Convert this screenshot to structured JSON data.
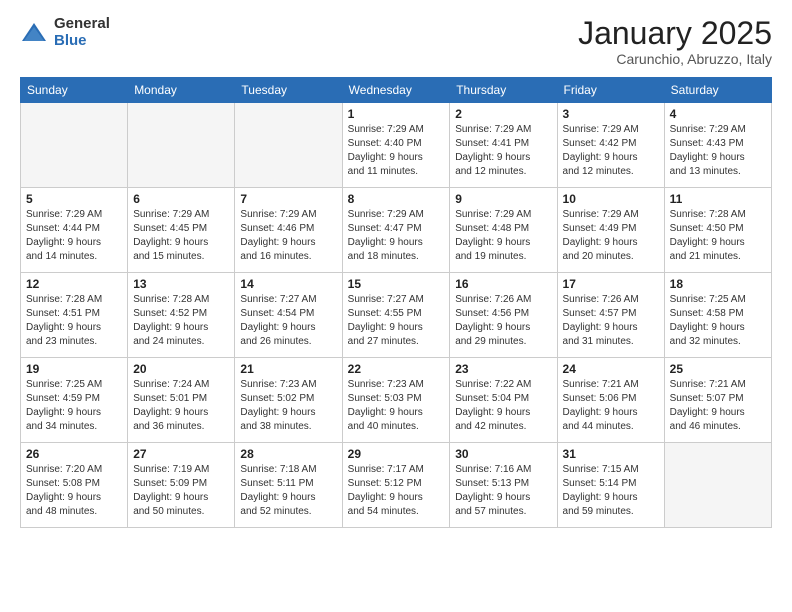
{
  "logo": {
    "general": "General",
    "blue": "Blue"
  },
  "title": "January 2025",
  "location": "Carunchio, Abruzzo, Italy",
  "days_header": [
    "Sunday",
    "Monday",
    "Tuesday",
    "Wednesday",
    "Thursday",
    "Friday",
    "Saturday"
  ],
  "weeks": [
    [
      {
        "num": "",
        "info": ""
      },
      {
        "num": "",
        "info": ""
      },
      {
        "num": "",
        "info": ""
      },
      {
        "num": "1",
        "info": "Sunrise: 7:29 AM\nSunset: 4:40 PM\nDaylight: 9 hours\nand 11 minutes."
      },
      {
        "num": "2",
        "info": "Sunrise: 7:29 AM\nSunset: 4:41 PM\nDaylight: 9 hours\nand 12 minutes."
      },
      {
        "num": "3",
        "info": "Sunrise: 7:29 AM\nSunset: 4:42 PM\nDaylight: 9 hours\nand 12 minutes."
      },
      {
        "num": "4",
        "info": "Sunrise: 7:29 AM\nSunset: 4:43 PM\nDaylight: 9 hours\nand 13 minutes."
      }
    ],
    [
      {
        "num": "5",
        "info": "Sunrise: 7:29 AM\nSunset: 4:44 PM\nDaylight: 9 hours\nand 14 minutes."
      },
      {
        "num": "6",
        "info": "Sunrise: 7:29 AM\nSunset: 4:45 PM\nDaylight: 9 hours\nand 15 minutes."
      },
      {
        "num": "7",
        "info": "Sunrise: 7:29 AM\nSunset: 4:46 PM\nDaylight: 9 hours\nand 16 minutes."
      },
      {
        "num": "8",
        "info": "Sunrise: 7:29 AM\nSunset: 4:47 PM\nDaylight: 9 hours\nand 18 minutes."
      },
      {
        "num": "9",
        "info": "Sunrise: 7:29 AM\nSunset: 4:48 PM\nDaylight: 9 hours\nand 19 minutes."
      },
      {
        "num": "10",
        "info": "Sunrise: 7:29 AM\nSunset: 4:49 PM\nDaylight: 9 hours\nand 20 minutes."
      },
      {
        "num": "11",
        "info": "Sunrise: 7:28 AM\nSunset: 4:50 PM\nDaylight: 9 hours\nand 21 minutes."
      }
    ],
    [
      {
        "num": "12",
        "info": "Sunrise: 7:28 AM\nSunset: 4:51 PM\nDaylight: 9 hours\nand 23 minutes."
      },
      {
        "num": "13",
        "info": "Sunrise: 7:28 AM\nSunset: 4:52 PM\nDaylight: 9 hours\nand 24 minutes."
      },
      {
        "num": "14",
        "info": "Sunrise: 7:27 AM\nSunset: 4:54 PM\nDaylight: 9 hours\nand 26 minutes."
      },
      {
        "num": "15",
        "info": "Sunrise: 7:27 AM\nSunset: 4:55 PM\nDaylight: 9 hours\nand 27 minutes."
      },
      {
        "num": "16",
        "info": "Sunrise: 7:26 AM\nSunset: 4:56 PM\nDaylight: 9 hours\nand 29 minutes."
      },
      {
        "num": "17",
        "info": "Sunrise: 7:26 AM\nSunset: 4:57 PM\nDaylight: 9 hours\nand 31 minutes."
      },
      {
        "num": "18",
        "info": "Sunrise: 7:25 AM\nSunset: 4:58 PM\nDaylight: 9 hours\nand 32 minutes."
      }
    ],
    [
      {
        "num": "19",
        "info": "Sunrise: 7:25 AM\nSunset: 4:59 PM\nDaylight: 9 hours\nand 34 minutes."
      },
      {
        "num": "20",
        "info": "Sunrise: 7:24 AM\nSunset: 5:01 PM\nDaylight: 9 hours\nand 36 minutes."
      },
      {
        "num": "21",
        "info": "Sunrise: 7:23 AM\nSunset: 5:02 PM\nDaylight: 9 hours\nand 38 minutes."
      },
      {
        "num": "22",
        "info": "Sunrise: 7:23 AM\nSunset: 5:03 PM\nDaylight: 9 hours\nand 40 minutes."
      },
      {
        "num": "23",
        "info": "Sunrise: 7:22 AM\nSunset: 5:04 PM\nDaylight: 9 hours\nand 42 minutes."
      },
      {
        "num": "24",
        "info": "Sunrise: 7:21 AM\nSunset: 5:06 PM\nDaylight: 9 hours\nand 44 minutes."
      },
      {
        "num": "25",
        "info": "Sunrise: 7:21 AM\nSunset: 5:07 PM\nDaylight: 9 hours\nand 46 minutes."
      }
    ],
    [
      {
        "num": "26",
        "info": "Sunrise: 7:20 AM\nSunset: 5:08 PM\nDaylight: 9 hours\nand 48 minutes."
      },
      {
        "num": "27",
        "info": "Sunrise: 7:19 AM\nSunset: 5:09 PM\nDaylight: 9 hours\nand 50 minutes."
      },
      {
        "num": "28",
        "info": "Sunrise: 7:18 AM\nSunset: 5:11 PM\nDaylight: 9 hours\nand 52 minutes."
      },
      {
        "num": "29",
        "info": "Sunrise: 7:17 AM\nSunset: 5:12 PM\nDaylight: 9 hours\nand 54 minutes."
      },
      {
        "num": "30",
        "info": "Sunrise: 7:16 AM\nSunset: 5:13 PM\nDaylight: 9 hours\nand 57 minutes."
      },
      {
        "num": "31",
        "info": "Sunrise: 7:15 AM\nSunset: 5:14 PM\nDaylight: 9 hours\nand 59 minutes."
      },
      {
        "num": "",
        "info": ""
      }
    ]
  ]
}
